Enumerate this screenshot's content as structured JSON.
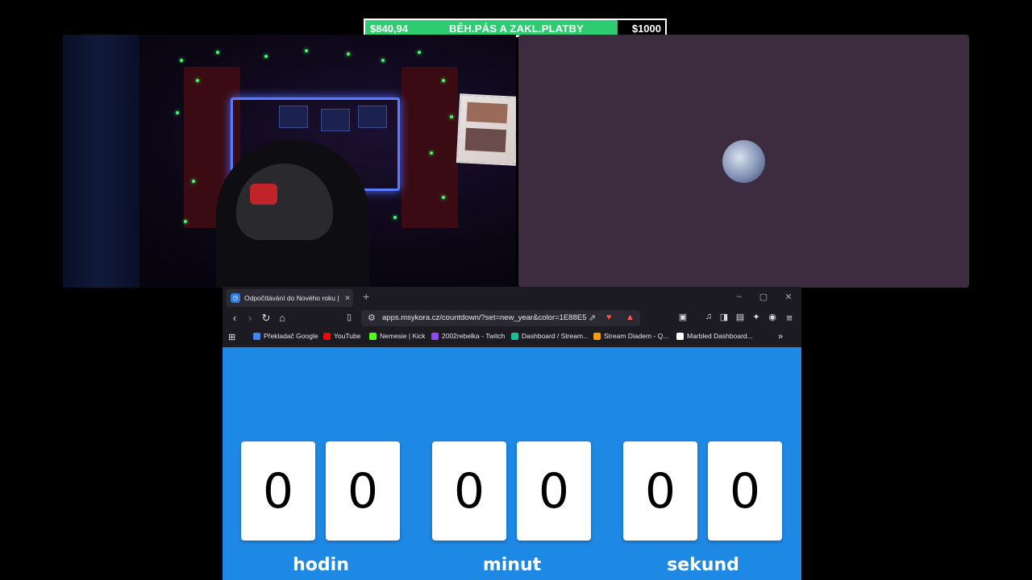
{
  "goal": {
    "current": "$840,94",
    "title": "BĚH.PÁS A ZAKL.PLATBY",
    "target": "$1000",
    "progress": 0.8409,
    "fill_color": "#2ecc71"
  },
  "browser": {
    "tab_title": "Odpočítávání do Nového roku |",
    "tab_close": "✕",
    "new_tab": "+",
    "window_controls": {
      "minimize": "–",
      "maximize": "▢",
      "close": "✕"
    },
    "url": "apps.msykora.cz/countdown/?set=new_year&color=1E88E5",
    "bookmarks": [
      {
        "label": "Překladač Google",
        "color": "#4285f4"
      },
      {
        "label": "YouTube",
        "color": "#ff0000"
      },
      {
        "label": "Nemesie | Kick",
        "color": "#53fc18"
      },
      {
        "label": "2002rebelka - Twitch",
        "color": "#9146ff"
      },
      {
        "label": "Dashboard / Stream...",
        "color": "#1abc9c"
      },
      {
        "label": "Stream Diadem - Q...",
        "color": "#f39c12"
      },
      {
        "label": "Marbled Dashboard...",
        "color": "#ffffff"
      }
    ],
    "more_bookmarks": "»"
  },
  "countdown": {
    "accent": "#1E88E5",
    "digits": [
      "0",
      "0",
      "0",
      "0",
      "0",
      "0"
    ],
    "units": [
      "hodin",
      "minut",
      "sekund"
    ]
  }
}
